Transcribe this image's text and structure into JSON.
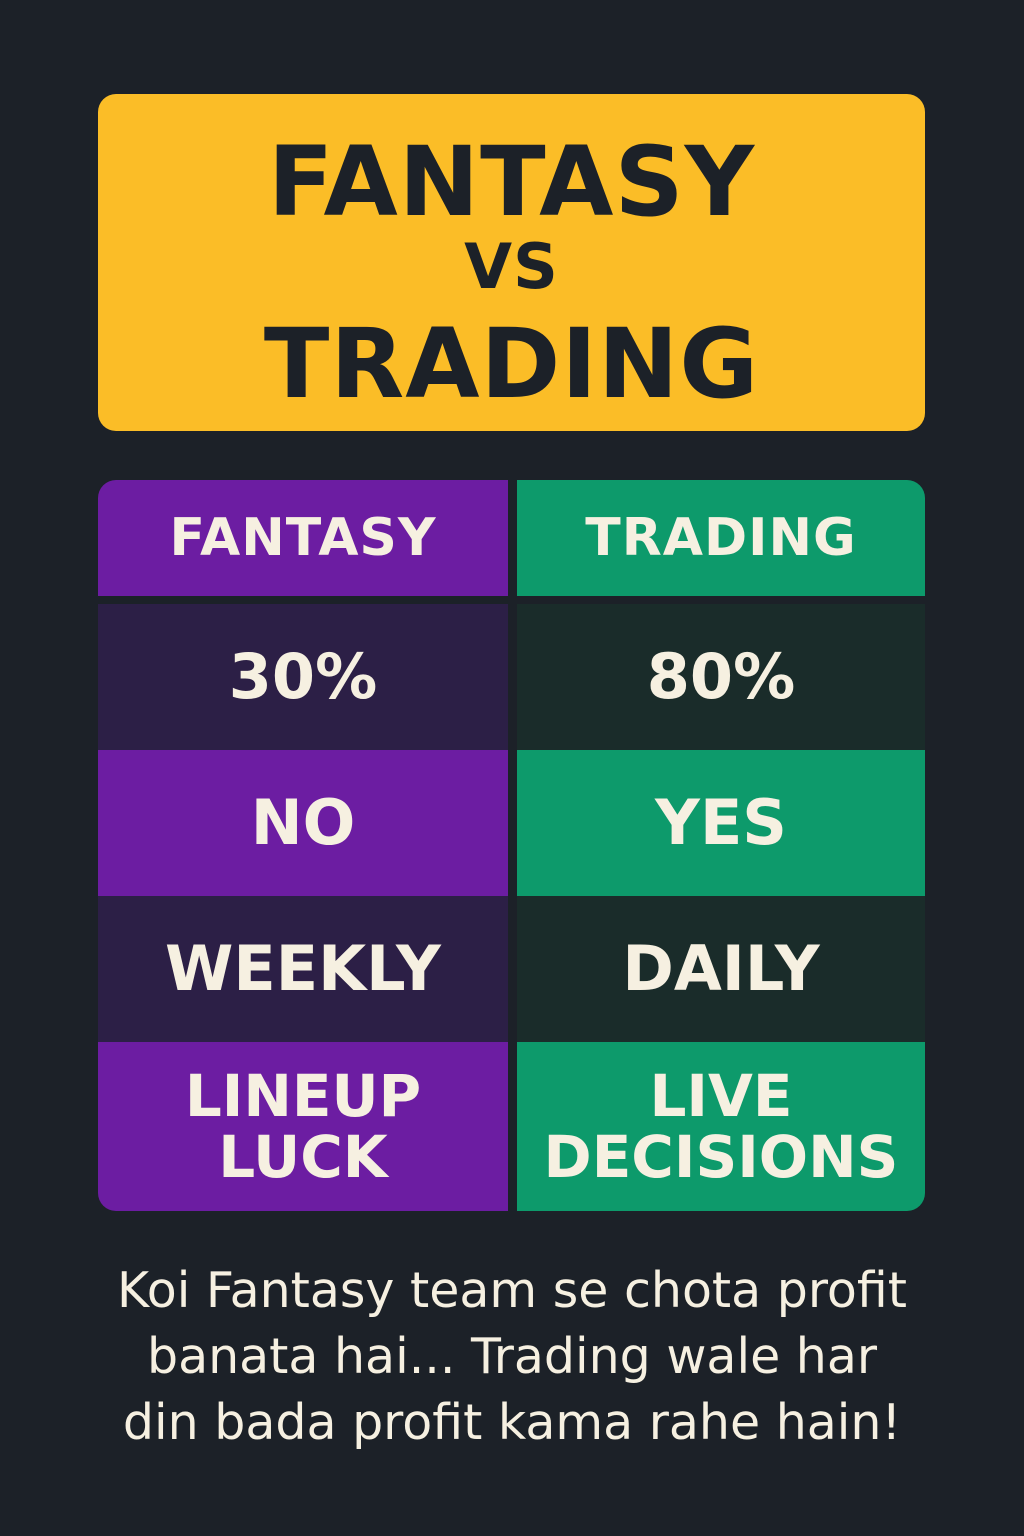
{
  "title": {
    "line1": "FANTASY",
    "line2": "VS",
    "line3": "TRADING"
  },
  "comparison": {
    "headers": {
      "left": "FANTASY",
      "right": "TRADING"
    },
    "rows": [
      {
        "left": "30%",
        "right": "80%"
      },
      {
        "left": "NO",
        "right": "YES"
      },
      {
        "left": "WEEKLY",
        "right": "DAILY"
      },
      {
        "left_line1": "LINEUP",
        "left_line2": "LUCK",
        "right_line1": "LIVE",
        "right_line2": "DECISIONS"
      }
    ]
  },
  "caption": {
    "line1": "Koi Fantasy team se chota profit",
    "line2": "banata hai... Trading wale har",
    "line3": "din bada profit kama rahe hain!"
  },
  "colors": {
    "background": "#1c2128",
    "title_card": "#fbbd27",
    "fantasy_bright": "#6c1da2",
    "fantasy_dark": "#2c1f46",
    "trading_bright": "#0d9a6b",
    "trading_dark": "#1a2c2a",
    "text_light": "#f6f0e1",
    "text_dark": "#1c2128"
  }
}
